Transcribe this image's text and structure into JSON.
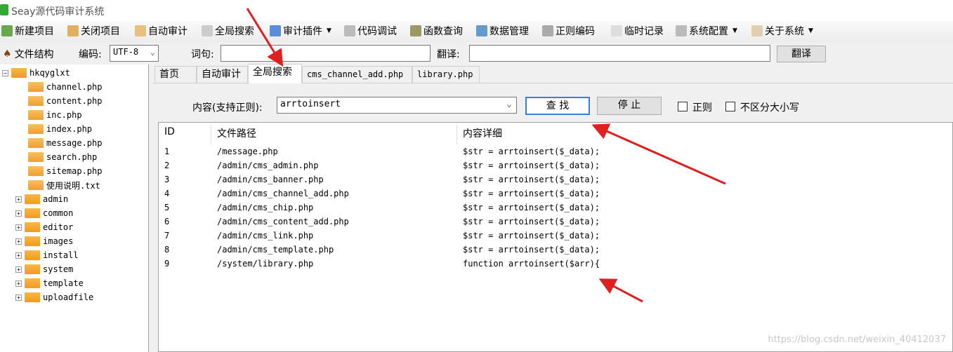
{
  "window": {
    "title": "Seay源代码审计系统"
  },
  "toolbar": [
    {
      "label": "新建项目",
      "icon": "new-project-icon",
      "color": "#6aa84f"
    },
    {
      "label": "关闭项目",
      "icon": "close-project-icon",
      "color": "#e0b060"
    },
    {
      "label": "自动审计",
      "icon": "auto-audit-icon",
      "color": "#e8c080"
    },
    {
      "label": "全局搜索",
      "icon": "global-search-icon",
      "color": "#cccccc"
    },
    {
      "label": "审计插件",
      "icon": "plugin-icon",
      "color": "#5b8dd9",
      "dropdown": true
    },
    {
      "label": "代码调试",
      "icon": "debug-icon",
      "color": "#bbbbbb"
    },
    {
      "label": "函数查询",
      "icon": "function-search-icon",
      "color": "#999966"
    },
    {
      "label": "数据管理",
      "icon": "data-manage-icon",
      "color": "#6699cc"
    },
    {
      "label": "正则编码",
      "icon": "regex-icon",
      "color": "#aaaaaa"
    },
    {
      "label": "临时记录",
      "icon": "notes-icon",
      "color": "#dddddd"
    },
    {
      "label": "系统配置",
      "icon": "gear-icon",
      "color": "#bbbbbb",
      "dropdown": true
    },
    {
      "label": "关于系统",
      "icon": "about-icon",
      "color": "#e0d0b0",
      "dropdown": true
    }
  ],
  "row2": {
    "file_structure": "文件结构",
    "encoding_label": "编码:",
    "encoding_value": "UTF-8",
    "word_label": "词句:",
    "word_value": "",
    "translate_label": "翻译:",
    "translate_value": "",
    "translate_button": "翻译"
  },
  "tree": {
    "root": "hkqyglxt",
    "files": [
      "channel.php",
      "content.php",
      "inc.php",
      "index.php",
      "message.php",
      "search.php",
      "sitemap.php",
      "使用说明.txt"
    ],
    "folders": [
      "admin",
      "common",
      "editor",
      "images",
      "install",
      "system",
      "template",
      "uploadfile"
    ]
  },
  "tabs": [
    {
      "label": "首页"
    },
    {
      "label": "自动审计"
    },
    {
      "label": "全局搜索",
      "active": true
    },
    {
      "label": "cms_channel_add.php"
    },
    {
      "label": "library.php"
    }
  ],
  "search": {
    "label": "内容(支持正则):",
    "value": "arrtoinsert",
    "find_button": "查 找",
    "stop_button": "停 止",
    "regex_label": "正则",
    "regex_checked": false,
    "case_label": "不区分大小写",
    "case_checked": false
  },
  "results": {
    "columns": [
      "ID",
      "文件路径",
      "内容详细"
    ],
    "rows": [
      [
        "1",
        "/message.php",
        "$str = arrtoinsert($_data);"
      ],
      [
        "2",
        "/admin/cms_admin.php",
        "$str = arrtoinsert($_data);"
      ],
      [
        "3",
        "/admin/cms_banner.php",
        "$str = arrtoinsert($_data);"
      ],
      [
        "4",
        "/admin/cms_channel_add.php",
        "$str = arrtoinsert($_data);"
      ],
      [
        "5",
        "/admin/cms_chip.php",
        "$str = arrtoinsert($_data);"
      ],
      [
        "6",
        "/admin/cms_content_add.php",
        "$str = arrtoinsert($_data);"
      ],
      [
        "7",
        "/admin/cms_link.php",
        "$str = arrtoinsert($_data);"
      ],
      [
        "8",
        "/admin/cms_template.php",
        "$str = arrtoinsert($_data);"
      ],
      [
        "9",
        "/system/library.php",
        "function arrtoinsert($arr){"
      ]
    ]
  },
  "watermark": "https://blog.csdn.net/weixin_40412037",
  "annotation_color": "#e02020"
}
